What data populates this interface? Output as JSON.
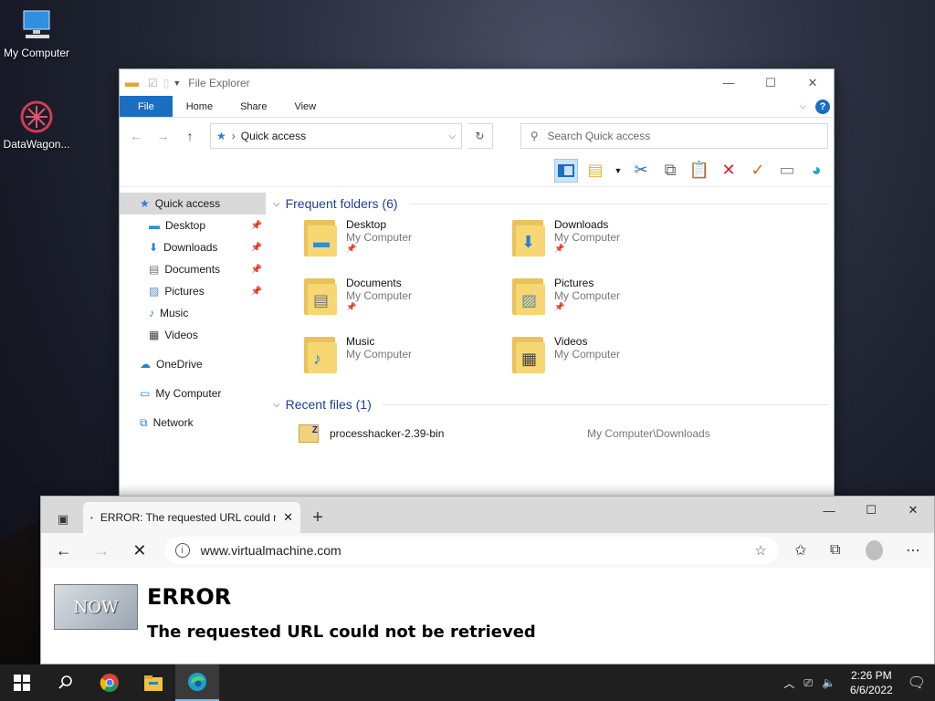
{
  "desktop": {
    "icons": [
      {
        "label": "My Computer"
      },
      {
        "label": "DataWagon..."
      }
    ]
  },
  "explorer": {
    "title": "File Explorer",
    "ribbon_tabs": [
      "File",
      "Home",
      "Share",
      "View"
    ],
    "address": "Quick access",
    "search_placeholder": "Search Quick access",
    "nav": {
      "quick_access": "Quick access",
      "items": [
        "Desktop",
        "Downloads",
        "Documents",
        "Pictures",
        "Music",
        "Videos"
      ],
      "onedrive": "OneDrive",
      "my_computer": "My Computer",
      "network": "Network"
    },
    "frequent_header": "Frequent folders (6)",
    "folders": [
      {
        "name": "Desktop",
        "location": "My Computer"
      },
      {
        "name": "Downloads",
        "location": "My Computer"
      },
      {
        "name": "Documents",
        "location": "My Computer"
      },
      {
        "name": "Pictures",
        "location": "My Computer"
      },
      {
        "name": "Music",
        "location": "My Computer"
      },
      {
        "name": "Videos",
        "location": "My Computer"
      }
    ],
    "recent_header": "Recent files (1)",
    "recent_files": [
      {
        "name": "processhacker-2.39-bin",
        "location": "My Computer\\Downloads"
      }
    ]
  },
  "browser": {
    "tab_title": "ERROR: The requested URL could not be retrieved",
    "url": "www.virtualmachine.com",
    "logo_text": "NOW",
    "error_title": "ERROR",
    "error_message": "The requested URL could not be retrieved"
  },
  "taskbar": {
    "time": "2:26 PM",
    "date": "6/6/2022"
  }
}
